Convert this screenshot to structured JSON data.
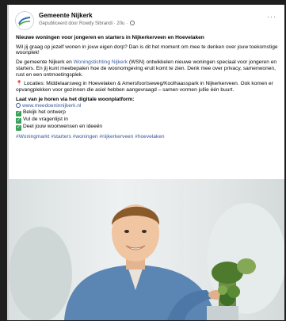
{
  "post": {
    "page_name": "Gemeente Nijkerk",
    "meta": "Gepubliceerd door Rowdy Sibrandi · 20u ·",
    "more_label": "···",
    "title": "Nieuwe woningen voor jongeren en starters in Nijkerkerveen en Hoevelaken",
    "intro": "Wil jij graag op jezelf wonen in jouw eigen dorp? Dan is dit het moment om mee te denken over jouw toekomstige woonplek!",
    "p2_part1": "De gemeente Nijkerk en ",
    "p2_link": "Woningstichting Nijkerk",
    "p2_part2": " (WSN) ontwikkelen nieuwe woningen speciaal voor jongeren en starters. En jij kunt meebepalen hoe de woonomgeving eruit komt te zien. Denk mee over privacy, samenwonen, rust en een ontmoetingsplek.",
    "locations": "Locaties: Middelaarsweg in Hoevelaken & Amersfoortseweg/Koolhaasspark in Nijkerkerveen. Ook komen er opvangplekken voor gezinnen die asiel hebben aangevraagd – samen vormen jullie één buurt.",
    "cta_heading": "Laat van je horen via het digitale woonplatform:",
    "website": "www.meedoeninnijkerk.nl",
    "bullets": [
      "Bekijk het ontwerp",
      "Vul de vragenlijst in",
      "Deel jouw woonwensen en ideeën"
    ],
    "hashtags": "#Woningmarkt #starters #woningen #nijkerkerveen #hoevelaken"
  },
  "colors": {
    "link": "#385898",
    "check": "#3aa35b",
    "shirt": "#5b86b4"
  }
}
